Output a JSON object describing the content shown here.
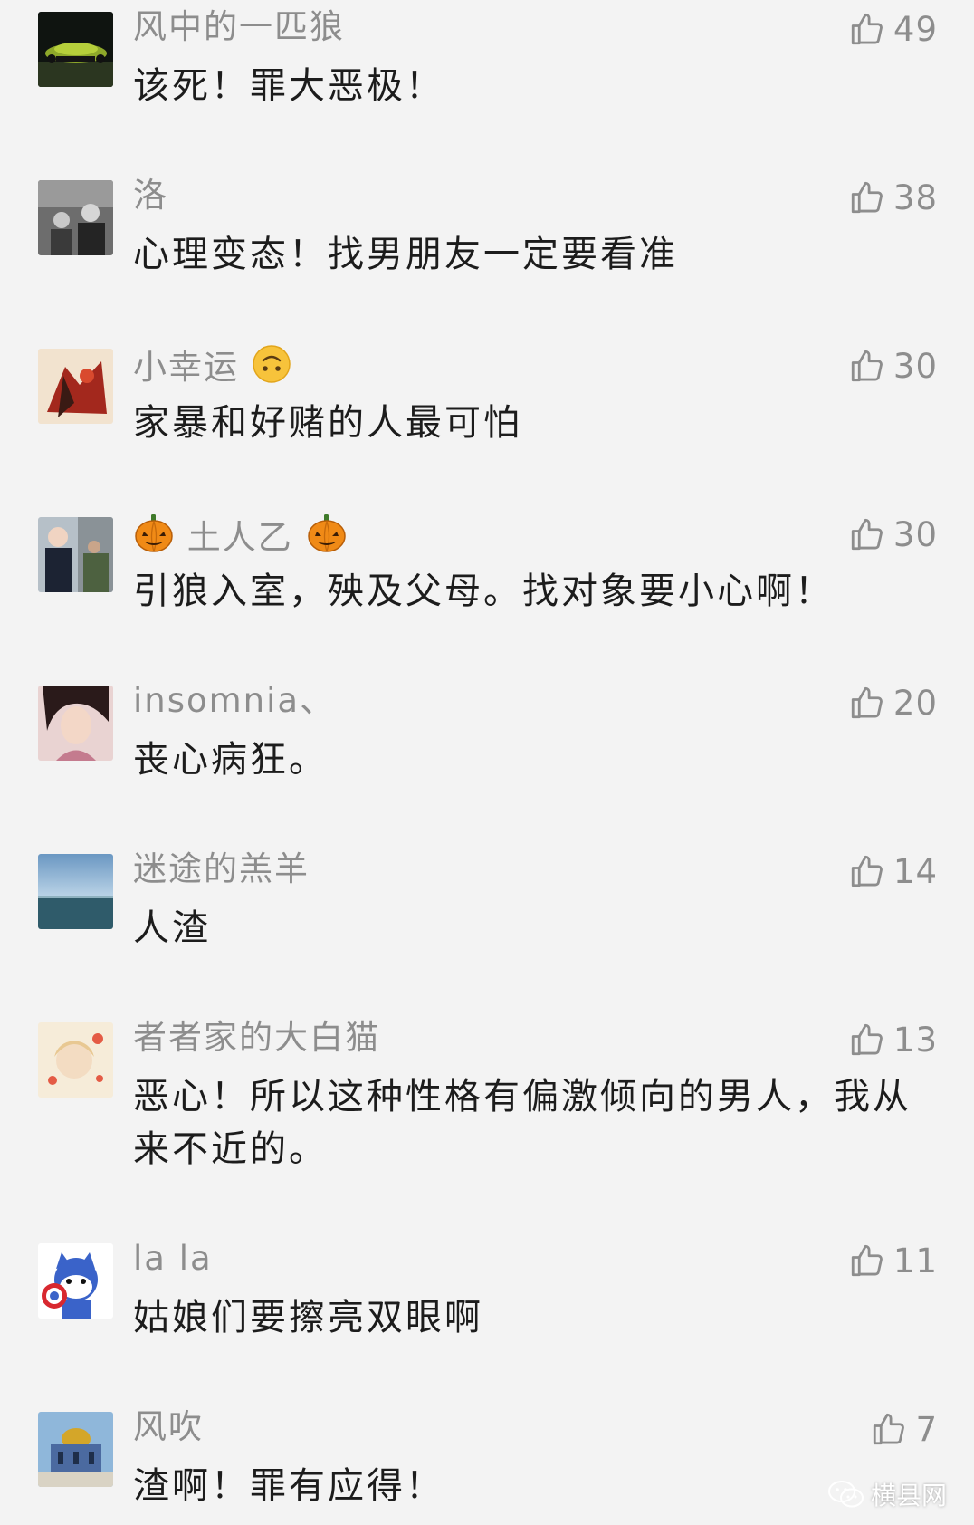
{
  "comments": [
    {
      "name": "风中的一匹狼",
      "text": "该死！罪大恶极！",
      "likes": "49"
    },
    {
      "name": "洛",
      "text": "心理变态！找男朋友一定要看准",
      "likes": "38"
    },
    {
      "name": "小幸运",
      "text": "家暴和好赌的人最可怕",
      "likes": "30"
    },
    {
      "name": "土人乙",
      "text": "引狼入室，殃及父母。找对象要小心啊！",
      "likes": "30"
    },
    {
      "name": "insomnia、",
      "text": "丧心病狂。",
      "likes": "20"
    },
    {
      "name": "迷途的羔羊",
      "text": "人渣",
      "likes": "14"
    },
    {
      "name": "者者家的大白猫",
      "text": "恶心！所以这种性格有偏激倾向的男人，我从来不近的。",
      "likes": "13"
    },
    {
      "name": "la la",
      "text": "姑娘们要擦亮双眼啊",
      "likes": "11"
    },
    {
      "name": "风吹",
      "text": "渣啊！罪有应得！",
      "likes": "7"
    }
  ],
  "watermark": {
    "label": "横县网"
  },
  "icons": {
    "like": "thumbs-up-icon",
    "watermark": "wechat-icon"
  },
  "colors": {
    "background": "#f3f3f3",
    "name": "#8d8d8d",
    "text": "#1c1c1c"
  }
}
